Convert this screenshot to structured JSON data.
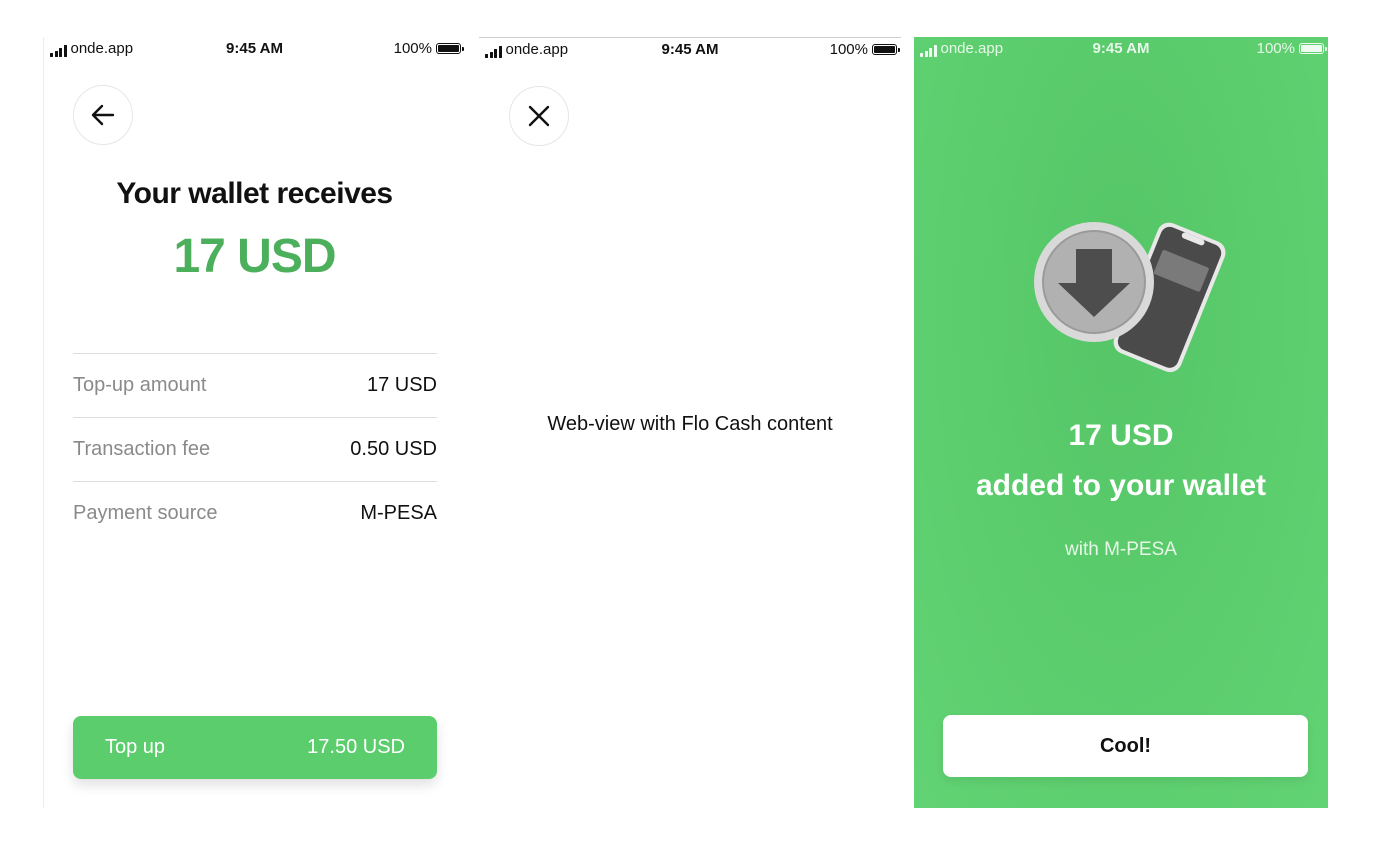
{
  "status_bar": {
    "carrier": "onde.app",
    "time": "9:45 AM",
    "battery": "100%"
  },
  "screen1": {
    "back_icon": "arrow-left-icon",
    "title": "Your wallet receives",
    "amount": "17 USD",
    "rows": [
      {
        "label": "Top-up amount",
        "value": "17 USD"
      },
      {
        "label": "Transaction fee",
        "value": "0.50 USD"
      },
      {
        "label": "Payment source",
        "value": "M-PESA"
      }
    ],
    "button": {
      "label": "Top up",
      "amount": "17.50 USD"
    }
  },
  "screen2": {
    "close_icon": "close-icon",
    "webview_text": "Web-view with Flo Cash content"
  },
  "screen3": {
    "illustration": "download-phone-icon",
    "amount": "17 USD",
    "message": "added to your wallet",
    "subtext": "with M-PESA",
    "button_label": "Cool!"
  },
  "colors": {
    "accent_green": "#5ccd6d",
    "amount_green": "#4caf5c",
    "success_bg": "#5bcc6c"
  }
}
